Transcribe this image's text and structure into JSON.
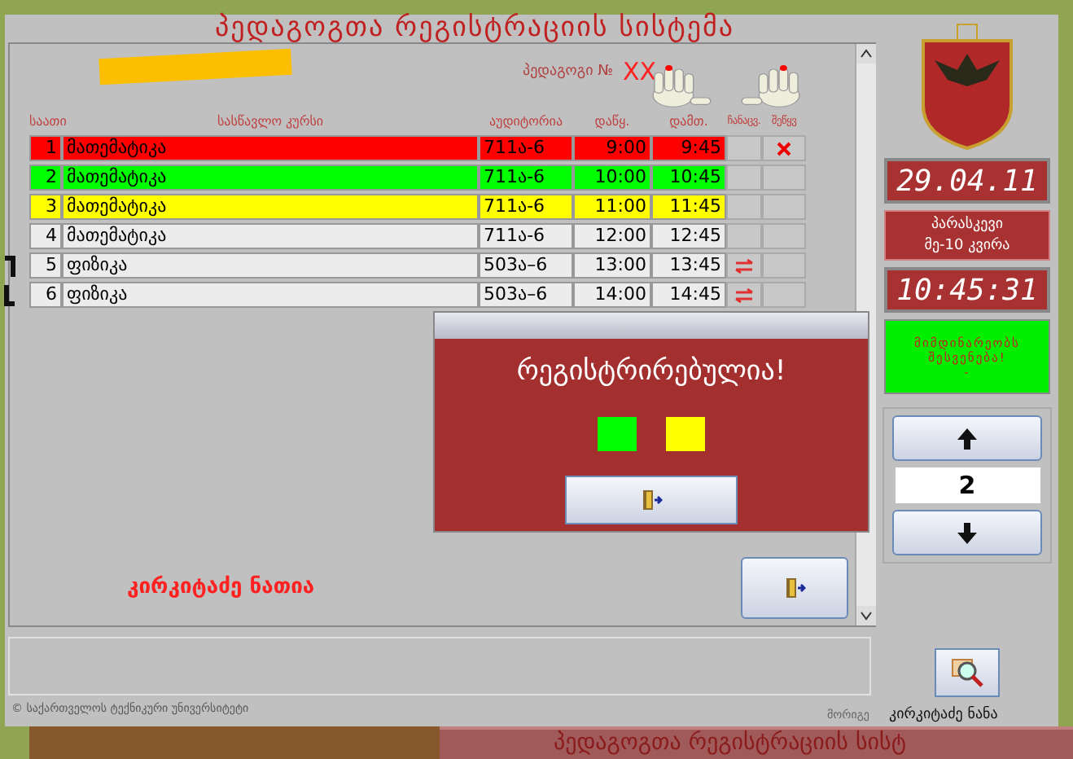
{
  "window": {
    "title": "პედაგოგთა რეგისტრაციის სისტემა"
  },
  "teacher": {
    "label": "პედაგოგი №",
    "number": "XX"
  },
  "table": {
    "columns": [
      "საათი",
      "სასწავლო კურსი",
      "აუდიტორია",
      "დაწყ.",
      "დამთ.",
      "ჩანაცვ.",
      "შეწყვ"
    ],
    "rows": [
      {
        "number": "1",
        "course": "მათემატიკა",
        "room": "711ა-6",
        "start": "9:00",
        "end": "9:45",
        "color": "#ff0000",
        "grouped": false,
        "replaced": false,
        "cancelled": true
      },
      {
        "number": "2",
        "course": "მათემატიკა",
        "room": "711ა-6",
        "start": "10:00",
        "end": "10:45",
        "color": "#00ff00",
        "grouped": false,
        "replaced": false,
        "cancelled": false
      },
      {
        "number": "3",
        "course": "მათემატიკა",
        "room": "711ა-6",
        "start": "11:00",
        "end": "11:45",
        "color": "#ffff00",
        "grouped": false,
        "replaced": false,
        "cancelled": false
      },
      {
        "number": "4",
        "course": "მათემატიკა",
        "room": "711ა-6",
        "start": "12:00",
        "end": "12:45",
        "color": "#ececec",
        "grouped": false,
        "replaced": false,
        "cancelled": false
      },
      {
        "number": "5",
        "course": "ფიზიკა",
        "room": "503ა–6",
        "start": "13:00",
        "end": "13:45",
        "color": "#ececec",
        "grouped": true,
        "replaced": true,
        "cancelled": false
      },
      {
        "number": "6",
        "course": "ფიზიკა",
        "room": "503ა–6",
        "start": "14:00",
        "end": "14:45",
        "color": "#ececec",
        "grouped": true,
        "replaced": true,
        "cancelled": false
      }
    ]
  },
  "current_teacher": "კირკიტაძე ნათია",
  "date": "29.04.11",
  "weekday": "პარასკევი",
  "week": "მე-10 კვირა",
  "time": "10:45:31",
  "status": {
    "lines": [
      "მიმდინარეობს",
      "შესვენება!",
      "-"
    ]
  },
  "counter": "2",
  "dialog": {
    "message": "რეგისტრირებულია!",
    "swatches": [
      {
        "color": "#00ff00"
      },
      {
        "color": "#ffff00"
      }
    ]
  },
  "footer": "© საქართველოს ტექნიკური უნივერსიტეტი",
  "duty": {
    "label": "მორიგე",
    "name": "კირკიტაძე ნანა"
  },
  "background_window": {
    "title": "პედაგოგთა რეგისტრაციის სისტ"
  }
}
